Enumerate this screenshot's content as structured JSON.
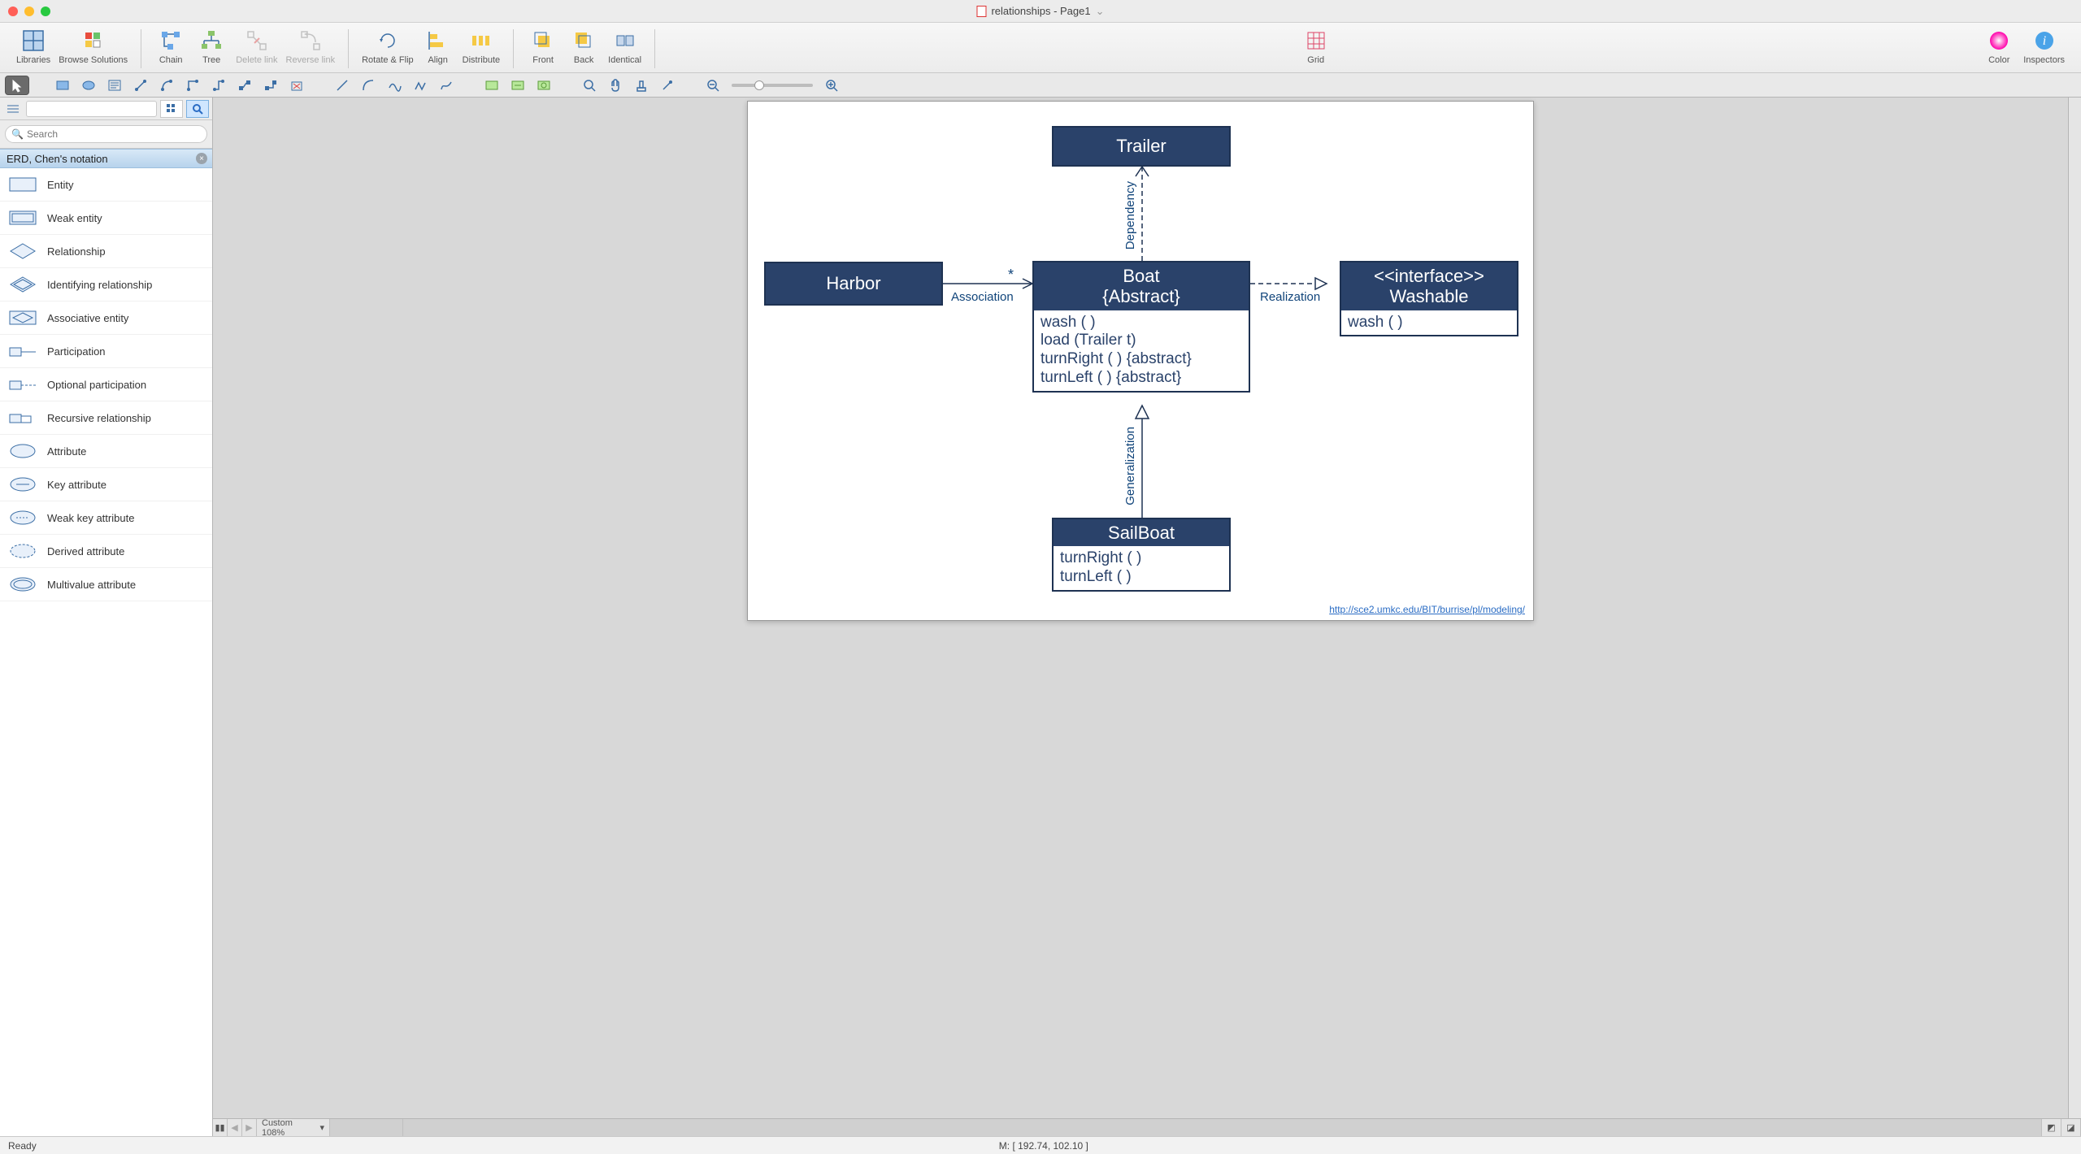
{
  "title": "relationships - Page1",
  "toolbar": {
    "libraries": "Libraries",
    "browse": "Browse Solutions",
    "chain": "Chain",
    "tree": "Tree",
    "delete_link": "Delete link",
    "reverse_link": "Reverse link",
    "rotate_flip": "Rotate & Flip",
    "align": "Align",
    "distribute": "Distribute",
    "front": "Front",
    "back": "Back",
    "identical": "Identical",
    "grid": "Grid",
    "color": "Color",
    "inspectors": "Inspectors"
  },
  "sidebar": {
    "search_placeholder": "Search",
    "category": "ERD, Chen's notation",
    "items": [
      "Entity",
      "Weak entity",
      "Relationship",
      "Identifying relationship",
      "Associative entity",
      "Participation",
      "Optional participation",
      "Recursive relationship",
      "Attribute",
      "Key attribute",
      "Weak key attribute",
      "Derived attribute",
      "Multivalue attribute"
    ]
  },
  "diagram": {
    "trailer": "Trailer",
    "harbor": "Harbor",
    "boat_hdr_l1": "Boat",
    "boat_hdr_l2": "{Abstract}",
    "boat_ops": [
      "wash ( )",
      "load (Trailer t)",
      "turnRight ( ) {abstract}",
      "turnLeft ( ) {abstract}"
    ],
    "washable_l1": "<<interface>>",
    "washable_l2": "Washable",
    "washable_ops": [
      "wash ( )"
    ],
    "sailboat": "SailBoat",
    "sailboat_ops": [
      "turnRight ( )",
      "turnLeft ( )"
    ],
    "assoc": "Association",
    "assoc_mult": "*",
    "dependency": "Dependency",
    "realization": "Realization",
    "generalization": "Generalization",
    "link": "http://sce2.umkc.edu/BIT/burrise/pl/modeling/"
  },
  "pager": {
    "zoom": "Custom 108%"
  },
  "status": {
    "ready": "Ready",
    "coords": "M: [ 192.74, 102.10 ]"
  }
}
